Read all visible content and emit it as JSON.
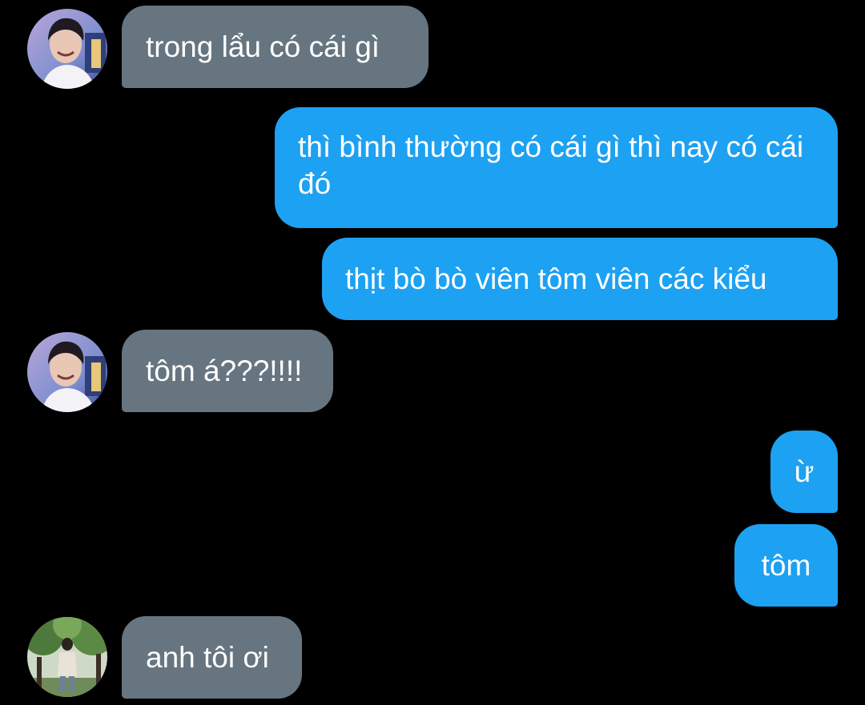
{
  "messages": [
    {
      "side": "in",
      "text": "trong lẩu có cái gì",
      "avatar": "avatar-boy-smiling"
    },
    {
      "side": "out",
      "text": "thì bình thường có cái gì thì nay có cái đó"
    },
    {
      "side": "out",
      "text": "thịt bò bò viên tôm viên các kiểu"
    },
    {
      "side": "in",
      "text": "tôm á???!!!!",
      "avatar": "avatar-boy-smiling"
    },
    {
      "side": "out",
      "text": "ừ"
    },
    {
      "side": "out",
      "text": "tôm"
    },
    {
      "side": "in",
      "text": "anh tôi ơi",
      "avatar": "avatar-person-outdoor"
    }
  ],
  "colors": {
    "background": "#000000",
    "incoming_bubble": "#66757f",
    "outgoing_bubble": "#1da1f2",
    "text": "#ffffff"
  }
}
